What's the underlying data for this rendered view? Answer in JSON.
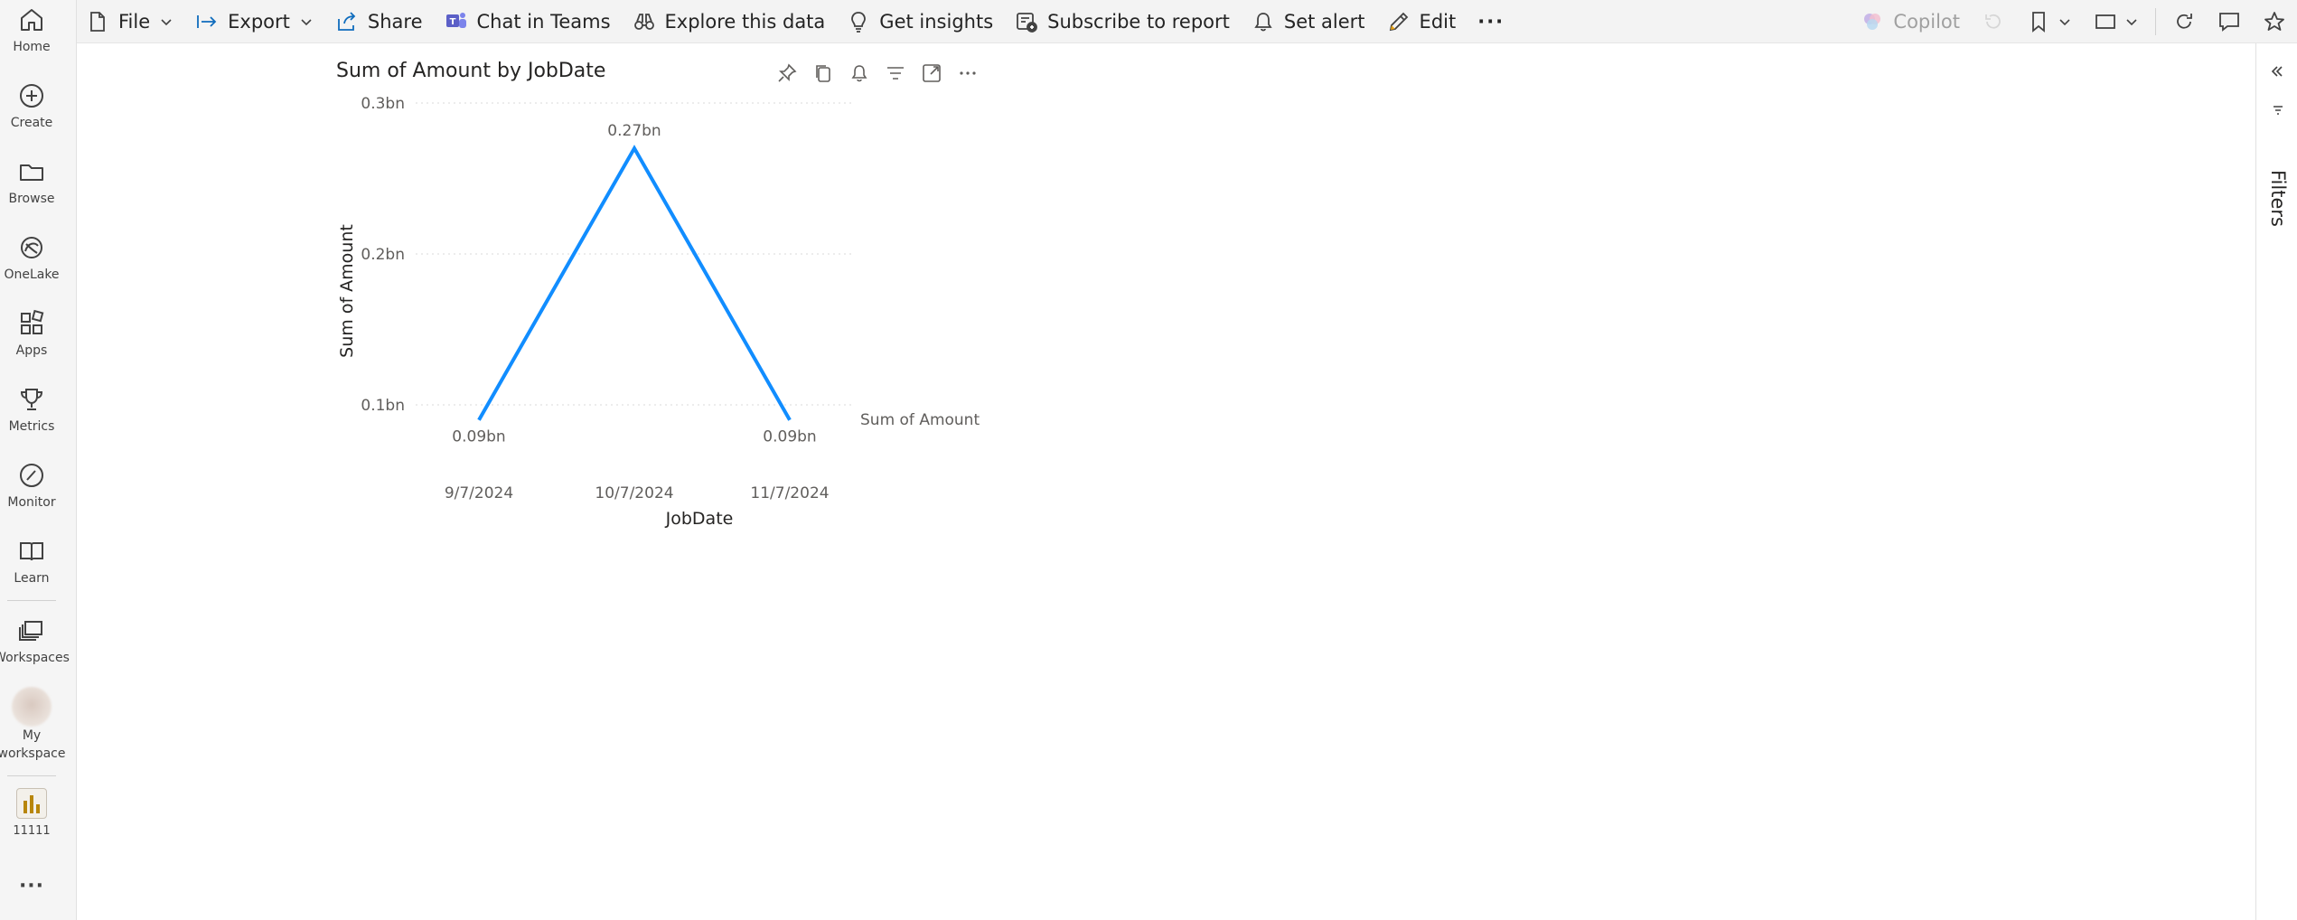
{
  "rail": {
    "items": [
      {
        "label": "Home"
      },
      {
        "label": "Create"
      },
      {
        "label": "Browse"
      },
      {
        "label": "OneLake"
      },
      {
        "label": "Apps"
      },
      {
        "label": "Metrics"
      },
      {
        "label": "Monitor"
      },
      {
        "label": "Learn"
      },
      {
        "label": "Workspaces"
      },
      {
        "label": "My\nworkspace"
      },
      {
        "label": "11111"
      }
    ],
    "more": "···"
  },
  "toolbar": {
    "file": "File",
    "export": "Export",
    "share": "Share",
    "chat_in_teams": "Chat in Teams",
    "explore": "Explore this data",
    "insights": "Get insights",
    "subscribe": "Subscribe to report",
    "alert": "Set alert",
    "edit": "Edit",
    "more": "···",
    "copilot": "Copilot"
  },
  "filters": {
    "label": "Filters"
  },
  "colors": {
    "line": "#118DFF",
    "accent_teams": "#5B5FC7"
  },
  "chart_data": {
    "type": "line",
    "title": "Sum of Amount by JobDate",
    "xlabel": "JobDate",
    "ylabel": "Sum of Amount",
    "categories": [
      "9/7/2024",
      "10/7/2024",
      "11/7/2024"
    ],
    "series": [
      {
        "name": "Sum of Amount",
        "values": [
          0.09,
          0.27,
          0.09
        ],
        "labels": [
          "0.09bn",
          "0.27bn",
          "0.09bn"
        ]
      }
    ],
    "yticks": [
      {
        "value": 0.1,
        "label": "0.1bn"
      },
      {
        "value": 0.2,
        "label": "0.2bn"
      },
      {
        "value": 0.3,
        "label": "0.3bn"
      }
    ],
    "ylim": [
      0.09,
      0.3
    ],
    "grid": true,
    "legend": "right"
  }
}
